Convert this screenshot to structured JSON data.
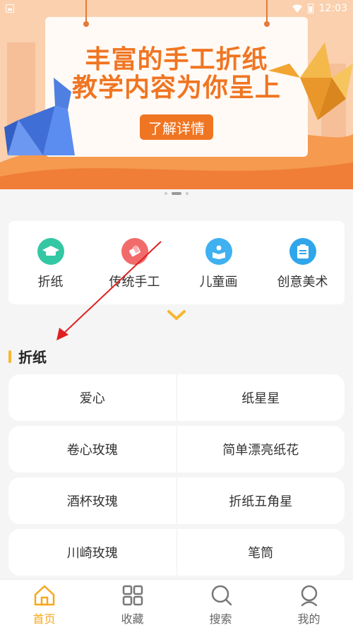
{
  "status_bar": {
    "time": "12:03"
  },
  "banner": {
    "title_line1": "丰富的手工折纸",
    "title_line2": "教学内容为你呈上",
    "button_label": "了解详情"
  },
  "categories": [
    {
      "label": "折纸",
      "icon": "graduation-cap-icon",
      "color": "#34c7a3"
    },
    {
      "label": "传统手工",
      "icon": "eraser-icon",
      "color": "#f26b6b"
    },
    {
      "label": "儿童画",
      "icon": "reading-icon",
      "color": "#3fb0f0"
    },
    {
      "label": "创意美术",
      "icon": "clipboard-icon",
      "color": "#2fa6ea"
    }
  ],
  "section": {
    "title": "折纸"
  },
  "items": [
    [
      "爱心",
      "纸星星"
    ],
    [
      "卷心玫瑰",
      "简单漂亮纸花"
    ],
    [
      "酒杯玫瑰",
      "折纸五角星"
    ],
    [
      "川崎玫瑰",
      "笔筒"
    ]
  ],
  "bottom_nav": [
    {
      "label": "首页",
      "icon": "home-icon",
      "active": true
    },
    {
      "label": "收藏",
      "icon": "grid-icon",
      "active": false
    },
    {
      "label": "搜索",
      "icon": "search-icon",
      "active": false
    },
    {
      "label": "我的",
      "icon": "profile-icon",
      "active": false
    }
  ],
  "colors": {
    "accent": "#f7a71b",
    "banner_orange": "#f07522"
  }
}
